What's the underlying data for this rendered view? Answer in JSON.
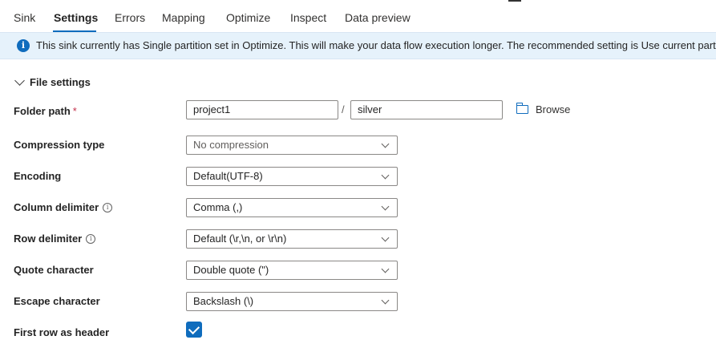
{
  "tabs": [
    {
      "label": "Sink"
    },
    {
      "label": "Settings"
    },
    {
      "label": "Errors"
    },
    {
      "label": "Mapping"
    },
    {
      "label": "Optimize"
    },
    {
      "label": "Inspect"
    },
    {
      "label": "Data preview"
    }
  ],
  "active_tab": "Settings",
  "banner": {
    "icon": "info-icon",
    "text": "This sink currently has Single partition set in Optimize. This will make your data flow execution longer. The recommended setting is Use current partitioning."
  },
  "section": {
    "title": "File settings",
    "expanded": true
  },
  "folder_path": {
    "label": "Folder path",
    "required_mark": "*",
    "container": "project1",
    "separator": "/",
    "directory": "silver",
    "browse_label": "Browse"
  },
  "compression_type": {
    "label": "Compression type",
    "value": "No compression"
  },
  "encoding": {
    "label": "Encoding",
    "value": "Default(UTF-8)"
  },
  "column_delimiter": {
    "label": "Column delimiter",
    "value": "Comma (,)"
  },
  "row_delimiter": {
    "label": "Row delimiter",
    "value": "Default (\\r,\\n, or \\r\\n)"
  },
  "quote_character": {
    "label": "Quote character",
    "value": "Double quote (\")"
  },
  "escape_character": {
    "label": "Escape character",
    "value": "Backslash (\\)"
  },
  "first_row_header": {
    "label": "First row as header",
    "checked": true
  },
  "colors": {
    "accent": "#0f6cbd",
    "banner_bg": "#e6f2fb",
    "required": "#c4314b"
  }
}
